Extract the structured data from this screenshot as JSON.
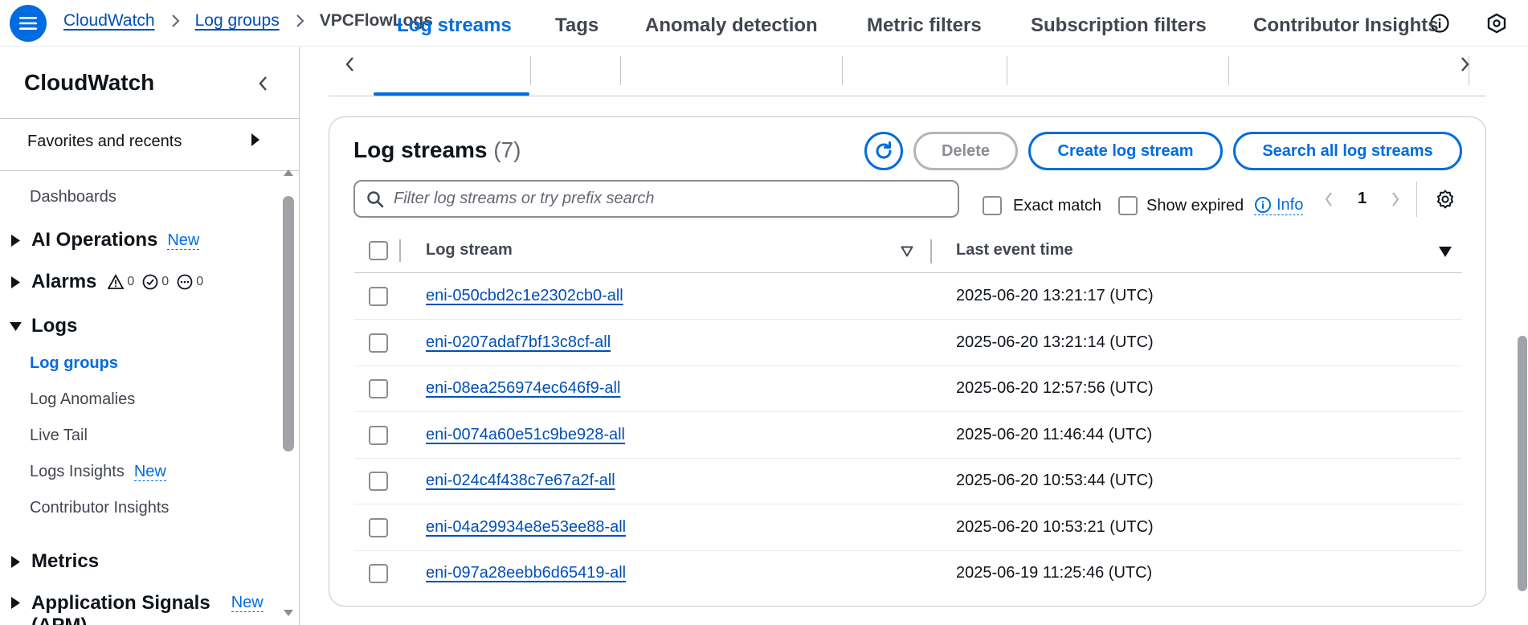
{
  "breadcrumb": {
    "items": [
      "CloudWatch",
      "Log groups"
    ],
    "current": "VPCFlowLogs"
  },
  "sidebar": {
    "title": "CloudWatch",
    "favorites": "Favorites and recents",
    "items_top": [
      "Dashboards"
    ],
    "ai_operations": {
      "label": "AI Operations",
      "badge": "New"
    },
    "alarms": {
      "label": "Alarms",
      "in_alarm": "0",
      "ok": "0",
      "insufficient": "0"
    },
    "logs": {
      "label": "Logs",
      "children": [
        {
          "label": "Log groups",
          "active": true
        },
        {
          "label": "Log Anomalies"
        },
        {
          "label": "Live Tail"
        },
        {
          "label": "Logs Insights",
          "badge": "New"
        },
        {
          "label": "Contributor Insights"
        }
      ]
    },
    "metrics": {
      "label": "Metrics"
    },
    "application_signals": {
      "label": "Application Signals",
      "label_cont": "(APM)",
      "badge": "New"
    }
  },
  "tabs": [
    "Log streams",
    "Tags",
    "Anomaly detection",
    "Metric filters",
    "Subscription filters",
    "Contributor Insights"
  ],
  "active_tab": "Log streams",
  "panel": {
    "title": "Log streams",
    "count": "(7)",
    "delete_label": "Delete",
    "create_label": "Create log stream",
    "search_all_label": "Search all log streams",
    "filter_placeholder": "Filter log streams or try prefix search",
    "exact_match": "Exact match",
    "show_expired": "Show expired",
    "info": "Info",
    "page": "1"
  },
  "table": {
    "columns": [
      "Log stream",
      "Last event time"
    ],
    "rows": [
      {
        "stream": "eni-050cbd2c1e2302cb0-all",
        "time": "2025-06-20 13:21:17 (UTC)"
      },
      {
        "stream": "eni-0207adaf7bf13c8cf-all",
        "time": "2025-06-20 13:21:14 (UTC)"
      },
      {
        "stream": "eni-08ea256974ec646f9-all",
        "time": "2025-06-20 12:57:56 (UTC)"
      },
      {
        "stream": "eni-0074a60e51c9be928-all",
        "time": "2025-06-20 11:46:44 (UTC)"
      },
      {
        "stream": "eni-024c4f438c7e67a2f-all",
        "time": "2025-06-20 10:53:44 (UTC)"
      },
      {
        "stream": "eni-04a29934e8e53ee88-all",
        "time": "2025-06-20 10:53:21 (UTC)"
      },
      {
        "stream": "eni-097a28eebb6d65419-all",
        "time": "2025-06-19 11:25:46 (UTC)"
      }
    ]
  },
  "colors": {
    "accent": "#006ce0",
    "link": "#0050b8",
    "border": "#c6c6cd"
  }
}
